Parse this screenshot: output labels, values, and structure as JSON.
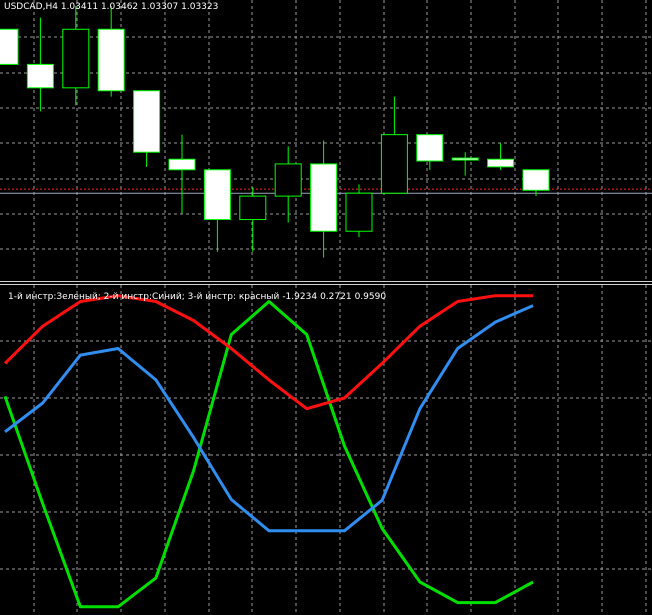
{
  "colors": {
    "background": "#000000",
    "grid": "#9a9a9a",
    "candle_outline": "#00ff00",
    "candle_bull_fill": "#ffffff",
    "candle_bear_fill": "#000000",
    "bid_line": "#ff2020",
    "ask_line": "#9aa8c0",
    "green": "#00e000",
    "blue": "#2f8ef0",
    "red": "#ff1010"
  },
  "header": {
    "symbol": "USDCAD,H4",
    "open": "1.03411",
    "high": "1.03462",
    "low": "1.03307",
    "close": "1.03323"
  },
  "indicator_panel": {
    "label_prefix": "1-й инстр:Зеленый; 2-й инстр:Синий; 3-й инстр: красный",
    "value_green": "-1.9234",
    "value_blue": "0.2721",
    "value_red": "0.9590"
  },
  "chart_data": [
    {
      "type": "candlestick",
      "title": "USDCAD,H4",
      "candles": [
        {
          "open": 1.0354,
          "high": 1.0354,
          "low": 1.0348,
          "close": 1.0348
        },
        {
          "open": 1.0348,
          "high": 1.0356,
          "low": 1.034,
          "close": 1.0344
        },
        {
          "open": 1.0344,
          "high": 1.0358,
          "low": 1.0341,
          "close": 1.0354
        },
        {
          "open": 1.0354,
          "high": 1.0358,
          "low": 1.03425,
          "close": 1.03435
        },
        {
          "open": 1.03435,
          "high": 1.03435,
          "low": 1.03305,
          "close": 1.0333
        },
        {
          "open": 1.03318,
          "high": 1.0336,
          "low": 1.03225,
          "close": 1.033
        },
        {
          "open": 1.033,
          "high": 1.033,
          "low": 1.0316,
          "close": 1.03215
        },
        {
          "open": 1.03215,
          "high": 1.0327,
          "low": 1.0316,
          "close": 1.03255
        },
        {
          "open": 1.03255,
          "high": 1.0334,
          "low": 1.0321,
          "close": 1.0331
        },
        {
          "open": 1.0331,
          "high": 1.0335,
          "low": 1.0315,
          "close": 1.03195
        },
        {
          "open": 1.03195,
          "high": 1.03275,
          "low": 1.03185,
          "close": 1.0326
        },
        {
          "open": 1.0326,
          "high": 1.03425,
          "low": 1.0326,
          "close": 1.0336
        },
        {
          "open": 1.0336,
          "high": 1.0336,
          "low": 1.033,
          "close": 1.03315
        },
        {
          "open": 1.0332,
          "high": 1.0333,
          "low": 1.0329,
          "close": 1.03318
        },
        {
          "open": 1.03318,
          "high": 1.03345,
          "low": 1.033,
          "close": 1.03305
        },
        {
          "open": 1.033,
          "high": 1.033,
          "low": 1.03255,
          "close": 1.03265
        }
      ],
      "bid_level": 1.03267,
      "ask_level": 1.0326,
      "ylim": [
        1.0311,
        1.0359
      ],
      "grid": true
    },
    {
      "type": "line",
      "title": "1-й инстр:Зеленый; 2-й инстр:Синий; 3-й инстр: красный",
      "x": [
        0,
        1,
        2,
        3,
        4,
        5,
        6,
        7,
        8,
        9,
        10,
        11,
        12,
        13,
        14
      ],
      "series": [
        {
          "name": "Зеленый",
          "color": "#00e000",
          "values": [
            0.7,
            -0.6,
            -1.85,
            -1.85,
            -1.5,
            -0.2,
            1.45,
            1.85,
            1.45,
            0.1,
            -0.9,
            -1.55,
            -1.8,
            -1.8,
            -1.55
          ]
        },
        {
          "name": "Синий",
          "color": "#2f8ef0",
          "values": [
            0.27,
            0.62,
            1.2,
            1.28,
            0.9,
            0.2,
            -0.55,
            -0.93,
            -0.93,
            -0.93,
            -0.56,
            0.55,
            1.28,
            1.6,
            1.8
          ]
        },
        {
          "name": "красный",
          "color": "#ff1010",
          "values": [
            1.1,
            1.55,
            1.85,
            1.92,
            1.85,
            1.62,
            1.28,
            0.9,
            0.55,
            0.68,
            1.1,
            1.55,
            1.85,
            1.92,
            1.92
          ]
        }
      ],
      "ylim": [
        -1.95,
        2.05
      ],
      "grid": true
    }
  ]
}
